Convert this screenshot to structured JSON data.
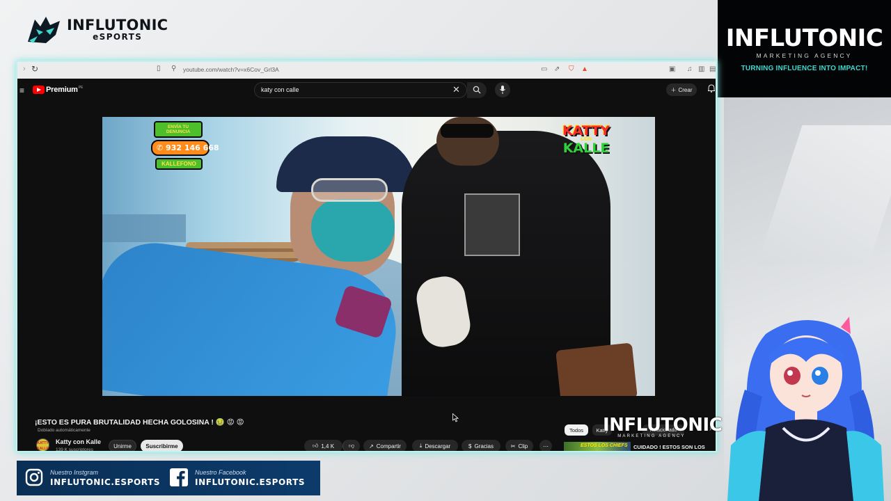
{
  "overlay": {
    "top_logo": {
      "line1": "INFLUTONIC",
      "line2": "eSPORTS"
    },
    "agency": {
      "brand": "INFLUTONIC",
      "sub": "MARKETING AGENCY",
      "tagline": "TURNING INFLUENCE INTO IMPACT!"
    },
    "watermark": {
      "brand": "INFLUTONIC",
      "sub": "MARKETING AGENCY"
    },
    "social": [
      {
        "network": "instagram-icon",
        "caption": "Nuestro Instgram",
        "handle": "INFLUTONIC.ESPORTS"
      },
      {
        "network": "facebook-icon",
        "caption": "Nuestro Facebook",
        "handle": "INFLUTONIC.ESPORTS"
      }
    ],
    "colors": {
      "accent": "#3fd9d0",
      "social_bg": "#0a2f55"
    }
  },
  "browser": {
    "url": "youtube.com/watch?v=x6Cov_Grl3A"
  },
  "youtube": {
    "logo_word": "Premium",
    "logo_region": "PE",
    "search_query": "katy con calle",
    "create_label": "Crear",
    "video": {
      "title": "¡ESTO ES PURA BRUTALIDAD HECHA GOLOSINA ! 🤢 😡 😡",
      "dub_tag": "Doblado automáticamente",
      "overlay_badge": {
        "line1": "ENVÍA TU DENUNCIA",
        "phone": "932 146 668",
        "line3": "KALLEFONO"
      },
      "overlay_logo": {
        "l1": "KATTY",
        "l2": "CON",
        "l3": "KALLE"
      }
    },
    "channel": {
      "name": "Katty con Kalle",
      "subscribers": "139 K suscriptores",
      "avatar_text": "KATTY KALLE"
    },
    "actions": {
      "join": "Unirme",
      "subscribe": "Suscribirme",
      "likes": "1,4 K",
      "share": "Compartir",
      "download": "Descargar",
      "thanks": "Gracias",
      "clip": "Clip"
    },
    "chips": [
      "Todos",
      "Katty",
      "Relacionado"
    ],
    "recommendation": {
      "thumb_text": "ESTOS LOS CHIEFS",
      "title": "CUIDADO ! ESTOS SON LOS"
    }
  }
}
